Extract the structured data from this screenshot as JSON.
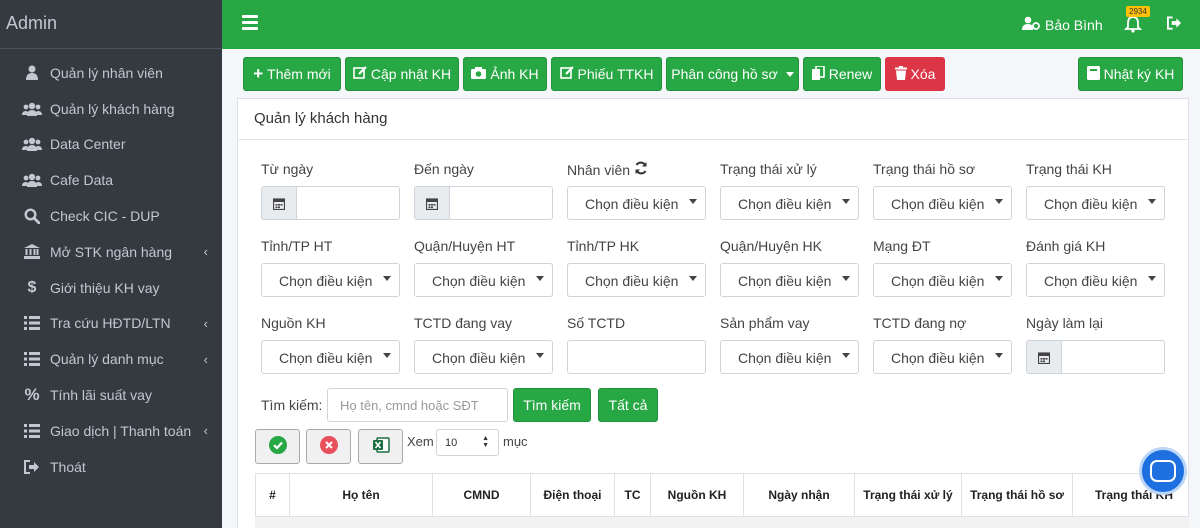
{
  "brand": "Admin",
  "sidebar": {
    "items": [
      {
        "label": "Quản lý nhân viên",
        "icon": "user-icon",
        "arrow": false
      },
      {
        "label": "Quản lý khách hàng",
        "icon": "users-icon",
        "arrow": false
      },
      {
        "label": "Data Center",
        "icon": "users-icon",
        "arrow": false
      },
      {
        "label": "Cafe Data",
        "icon": "users-icon",
        "arrow": false
      },
      {
        "label": "Check CIC - DUP",
        "icon": "search-icon",
        "arrow": false
      },
      {
        "label": "Mở STK ngân hàng",
        "icon": "bank-icon",
        "arrow": true
      },
      {
        "label": "Giới thiệu KH vay",
        "icon": "dollar-icon",
        "arrow": false
      },
      {
        "label": "Tra cứu HĐTD/LTN",
        "icon": "list-icon",
        "arrow": true
      },
      {
        "label": "Quản lý danh mục",
        "icon": "list-icon",
        "arrow": true
      },
      {
        "label": "Tính lãi suất vay",
        "icon": "percent-icon",
        "arrow": false
      },
      {
        "label": "Giao dịch | Thanh toán",
        "icon": "list-icon",
        "arrow": true
      },
      {
        "label": "Thoát",
        "icon": "logout-icon",
        "arrow": false
      }
    ],
    "arrow_glyph": "‹"
  },
  "header": {
    "user_name": "Bảo Bình",
    "notification_count": "2934"
  },
  "toolbar": {
    "add_label": "Thêm mới",
    "update_label": "Cập nhật KH",
    "photo_label": "Ảnh KH",
    "ticket_label": "Phiếu TTKH",
    "assign_label": "Phân công hồ sơ",
    "renew_label": "Renew",
    "delete_label": "Xóa",
    "log_label": "Nhật ký KH"
  },
  "card": {
    "title": "Quản lý khách hàng"
  },
  "filters": {
    "from_date": "Từ ngày",
    "to_date": "Đến ngày",
    "staff": "Nhân viên",
    "process_status": "Trạng thái xử lý",
    "file_status": "Trạng thái hồ sơ",
    "customer_status": "Trạng thái KH",
    "province_ht": "Tỉnh/TP HT",
    "district_ht": "Quận/Huyện HT",
    "province_hk": "Tỉnh/TP HK",
    "district_hk": "Quận/Huyện HK",
    "network": "Mạng ĐT",
    "rating": "Đánh giá KH",
    "source": "Nguồn KH",
    "lender": "TCTD đang vay",
    "lender_count": "Số TCTD",
    "loan_product": "Sản phẩm vay",
    "debt_lender": "TCTD đang nợ",
    "redo_date": "Ngày làm lại",
    "placeholder": "Chọn điều kiện"
  },
  "search": {
    "label": "Tìm kiếm:",
    "placeholder": "Họ tên, cmnd hoặc SĐT",
    "search_button": "Tìm kiếm",
    "all_button": "Tất cả"
  },
  "paging": {
    "show_label": "Xem",
    "page_size": "10",
    "unit_label": "mục"
  },
  "table": {
    "columns": [
      "#",
      "Họ tên",
      "CMND",
      "Điện thoại",
      "TC",
      "Nguồn KH",
      "Ngày nhận",
      "Trạng thái xử lý",
      "Trạng thái hồ sơ",
      "Trạng thái KH"
    ]
  },
  "colors": {
    "header_green": "#28a745",
    "sidebar_dark": "#343a40",
    "danger_red": "#dc3545"
  }
}
